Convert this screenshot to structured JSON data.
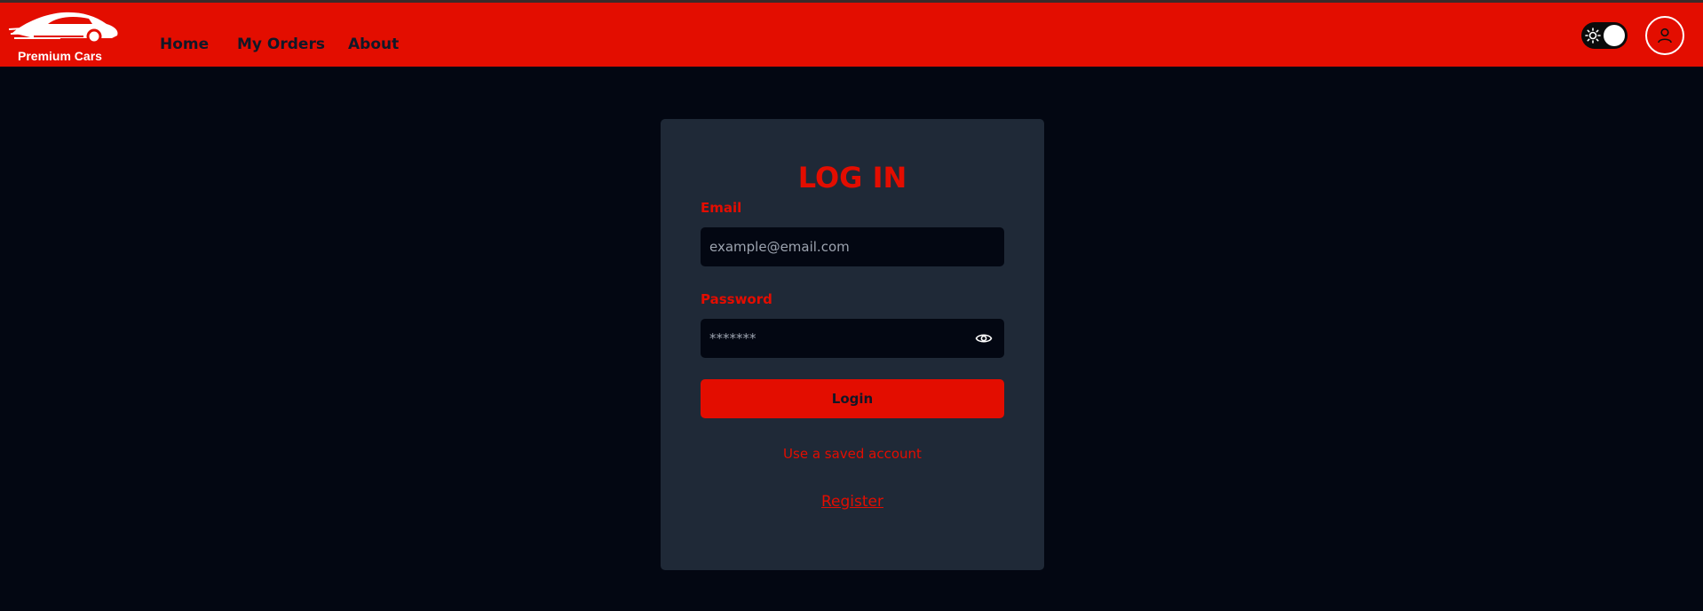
{
  "brand": {
    "name": "Premium Cars",
    "logo_icon": "car-logo-icon"
  },
  "nav": {
    "links": [
      "Home",
      "My Orders",
      "About"
    ]
  },
  "header": {
    "theme_toggle_icon": "sun-icon",
    "profile_icon": "user-icon"
  },
  "login": {
    "title": "LOG IN",
    "email_label": "Email",
    "email_placeholder": "example@email.com",
    "password_label": "Password",
    "password_placeholder": "*******",
    "password_visibility_icon": "eye-icon",
    "login_button": "Login",
    "saved_account_link": "Use a saved account",
    "register_link": "Register"
  },
  "colors": {
    "accent": "#e30d00",
    "background": "#030712",
    "card": "#1f2937"
  }
}
